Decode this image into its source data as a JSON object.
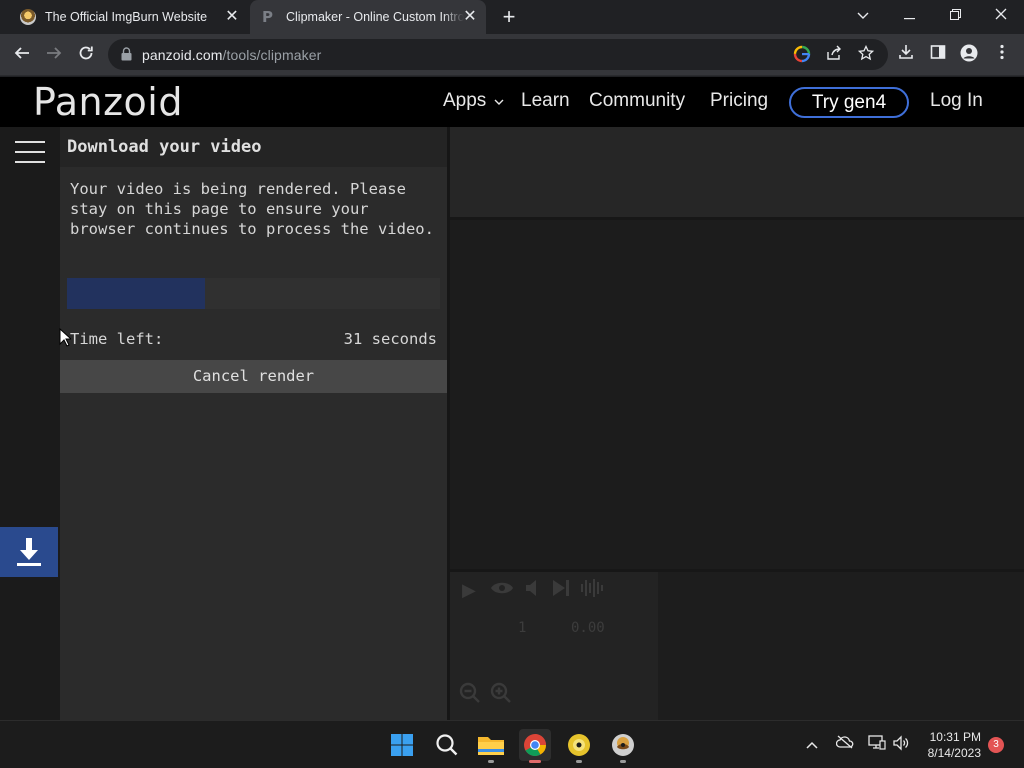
{
  "browser": {
    "tabs": [
      {
        "title": "The Official ImgBurn Website",
        "active": false
      },
      {
        "title": "Clipmaker - Online Custom Intro",
        "active": true
      }
    ],
    "url_host": "panzoid.com",
    "url_path": "/tools/clipmaker"
  },
  "site": {
    "logo": "Panzoid",
    "nav": {
      "apps": "Apps",
      "learn": "Learn",
      "community": "Community",
      "pricing": "Pricing",
      "try": "Try gen4",
      "login": "Log In"
    }
  },
  "panel": {
    "title": "Download your video",
    "message": "Your video is being rendered. Please stay on this page to ensure your browser continues to process the video.",
    "progress": 0.37,
    "time_label": "Time left:",
    "time_value": "31 seconds",
    "cancel_label": "Cancel render"
  },
  "timeline": {
    "frame": "1",
    "time": "0.00"
  },
  "taskbar": {
    "time": "10:31 PM",
    "date": "8/14/2023",
    "notification_count": "3"
  },
  "colors": {
    "accent": "#3f6fd8",
    "progress_fill": "#22325e",
    "download_button": "#2a4a8e"
  }
}
